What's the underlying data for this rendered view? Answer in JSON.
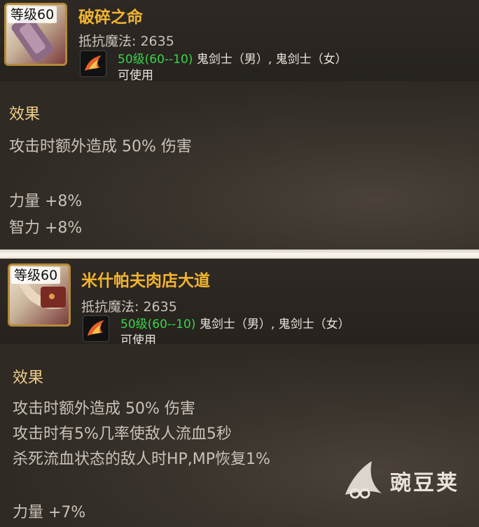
{
  "cards": [
    {
      "level_tag": "等级60",
      "name": "破碎之命",
      "resist": "抵抗魔法: 2635",
      "req_level": "50级(60--10)",
      "req_classes": "鬼剑士（男）, 鬼剑士（女）",
      "usable": "可使用",
      "effect_title": "效果",
      "lines": [
        "攻击时额外造成 50% 伤害",
        "",
        "力量 +8%",
        "智力 +8%"
      ]
    },
    {
      "level_tag": "等级60",
      "name": "米什帕夫肉店大道",
      "resist": "抵抗魔法: 2635",
      "req_level": "50级(60--10)",
      "req_classes": "鬼剑士（男）, 鬼剑士（女）",
      "usable": "可使用",
      "effect_title": "效果",
      "lines": [
        "攻击时额外造成 50% 伤害",
        "攻击时有5%几率使敌人流血5秒",
        "杀死流血状态的敌人时HP,MP恢复1%",
        "",
        "力量 +7%"
      ]
    }
  ],
  "watermark": "豌豆荚",
  "colors": {
    "name": "#f2b431",
    "level_req": "#39d44a",
    "effect_title": "#efcf8a"
  }
}
